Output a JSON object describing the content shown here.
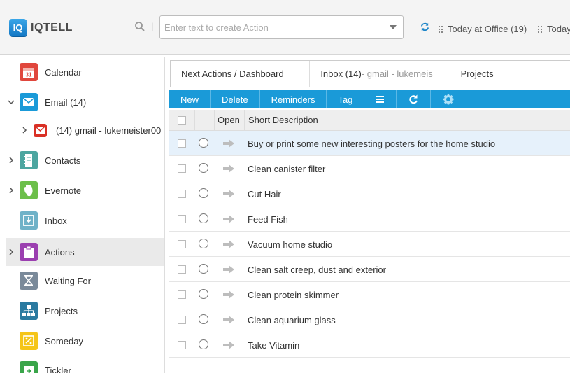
{
  "app": {
    "logo_mark": "IQ",
    "name": "IQTELL"
  },
  "header": {
    "search_separator": "|",
    "action_input_placeholder": "Enter text to create Action",
    "contexts": [
      {
        "label": "Today at Office (19)"
      },
      {
        "label": "Today"
      }
    ]
  },
  "sidebar": {
    "items": [
      {
        "label": "Calendar",
        "icon": "calendar-icon",
        "color": "#e0463c",
        "badge": "31"
      },
      {
        "label": "Email (14)",
        "icon": "email-icon",
        "color": "#1a9ad8",
        "expanded": true
      },
      {
        "label": "(14) gmail - lukemeister00",
        "icon": "gmail-icon",
        "color": "#d93025"
      },
      {
        "label": "Contacts",
        "icon": "contacts-icon",
        "color": "#4ca6a0"
      },
      {
        "label": "Evernote",
        "icon": "evernote-icon",
        "color": "#6cbf4a"
      },
      {
        "label": "Inbox",
        "icon": "inbox-icon",
        "color": "#6fb2c8"
      },
      {
        "label": "Actions",
        "icon": "actions-icon",
        "color": "#9b3fb0"
      },
      {
        "label": "Waiting For",
        "icon": "hourglass-icon",
        "color": "#7a8a9a"
      },
      {
        "label": "Projects",
        "icon": "projects-icon",
        "color": "#2a7aa0"
      },
      {
        "label": "Someday",
        "icon": "someday-icon",
        "color": "#f5c518"
      },
      {
        "label": "Tickler",
        "icon": "tickler-icon",
        "color": "#3aa54a"
      }
    ]
  },
  "tabs": [
    {
      "label": "Next Actions / Dashboard"
    },
    {
      "label": "Inbox (14)",
      "muted": " - gmail - lukemeis"
    },
    {
      "label": "Projects"
    }
  ],
  "toolbar": {
    "new_label": "New",
    "delete_label": "Delete",
    "reminders_label": "Reminders",
    "tag_label": "Tag"
  },
  "grid": {
    "columns": {
      "open": "Open",
      "description": "Short Description"
    },
    "rows": [
      {
        "description": "Buy or print some new interesting posters for the home studio"
      },
      {
        "description": "Clean canister filter"
      },
      {
        "description": "Cut Hair"
      },
      {
        "description": "Feed Fish"
      },
      {
        "description": "Vacuum home studio"
      },
      {
        "description": "Clean salt creep, dust and exterior"
      },
      {
        "description": "Clean protein skimmer"
      },
      {
        "description": "Clean aquarium glass"
      },
      {
        "description": "Take Vitamin"
      }
    ]
  },
  "colors": {
    "accent": "#1a9ad8",
    "topbar": "#f4f4f4",
    "selected_row": "#e6f1fb"
  }
}
